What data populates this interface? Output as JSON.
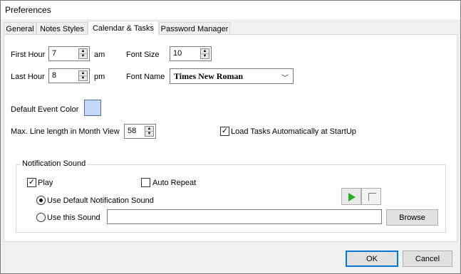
{
  "window": {
    "title": "Preferences"
  },
  "tabs": [
    {
      "label": "General"
    },
    {
      "label": "Notes Styles"
    },
    {
      "label": "Calendar & Tasks"
    },
    {
      "label": "Password Manager"
    }
  ],
  "calendar": {
    "first_hour_label": "First Hour",
    "first_hour_value": "7",
    "first_hour_suffix": "am",
    "last_hour_label": "Last Hour",
    "last_hour_value": "8",
    "last_hour_suffix": "pm",
    "font_size_label": "Font Size",
    "font_size_value": "10",
    "font_name_label": "Font Name",
    "font_name_value": "Times New Roman",
    "default_event_color_label": "Default Event Color",
    "default_event_color": "#c4d9f7",
    "max_line_label": "Max. Line length in Month View",
    "max_line_value": "58",
    "load_tasks_label": "Load Tasks Automatically at StartUp",
    "load_tasks_checked": true
  },
  "notification": {
    "group_title": "Notification Sound",
    "play_label": "Play",
    "play_checked": true,
    "auto_repeat_label": "Auto Repeat",
    "auto_repeat_checked": false,
    "use_default_label": "Use Default Notification Sound",
    "use_default_selected": true,
    "use_this_label": "Use this Sound",
    "use_this_selected": false,
    "sound_path": "",
    "browse_label": "Browse"
  },
  "footer": {
    "ok_label": "OK",
    "cancel_label": "Cancel"
  }
}
